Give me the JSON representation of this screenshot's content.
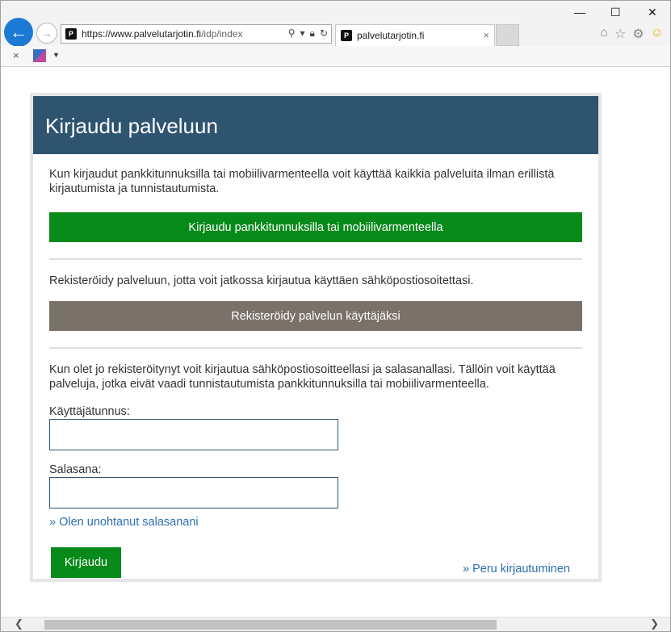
{
  "browser": {
    "address": {
      "host": "https://www.palvelutarjotin.fi",
      "path": "/idp/index"
    },
    "tab_title": "palvelutarjotin.fi",
    "tab_close": "×",
    "favicon_letter": "P",
    "window_controls": {
      "minimize": "—",
      "maximize": "☐",
      "close": "✕"
    },
    "icons": [
      "home-icon",
      "star-icon",
      "gear-icon",
      "smiley-icon"
    ]
  },
  "favorites_bar": {
    "close": "×",
    "arrow": "▼"
  },
  "card": {
    "title": "Kirjaudu palveluun",
    "intro": "Kun kirjaudut pankkitunnuksilla tai mobiilivarmenteella voit käyttää kaikkia palveluita ilman erillistä kirjautumista ja tunnistautumista.",
    "bank_button": "Kirjaudu pankkitunnuksilla tai mobiilivarmenteella",
    "register_text": "Rekisteröidy palveluun, jotta voit jatkossa kirjautua käyttäen sähköpostiosoitettasi.",
    "register_button": "Rekisteröidy palvelun käyttäjäksi",
    "login_text": "Kun olet jo rekisteröitynyt voit kirjautua sähköpostiosoitteellasi ja salasanallasi. Tällöin voit käyttää palveluja, jotka eivät vaadi tunnistautumista pankkitunnuksilla tai mobiilivarmenteella.",
    "username_label": "Käyttäjätunnus:",
    "username_value": "",
    "password_label": "Salasana:",
    "password_value": "",
    "forgot_link": "» Olen unohtanut salasanani",
    "login_button": "Kirjaudu",
    "cancel_link": "» Peru kirjautuminen"
  },
  "colors": {
    "header_bg": "#2e5470",
    "green_button": "#088a1b",
    "gray_button": "#7a7168",
    "link": "#2a6fb0"
  }
}
